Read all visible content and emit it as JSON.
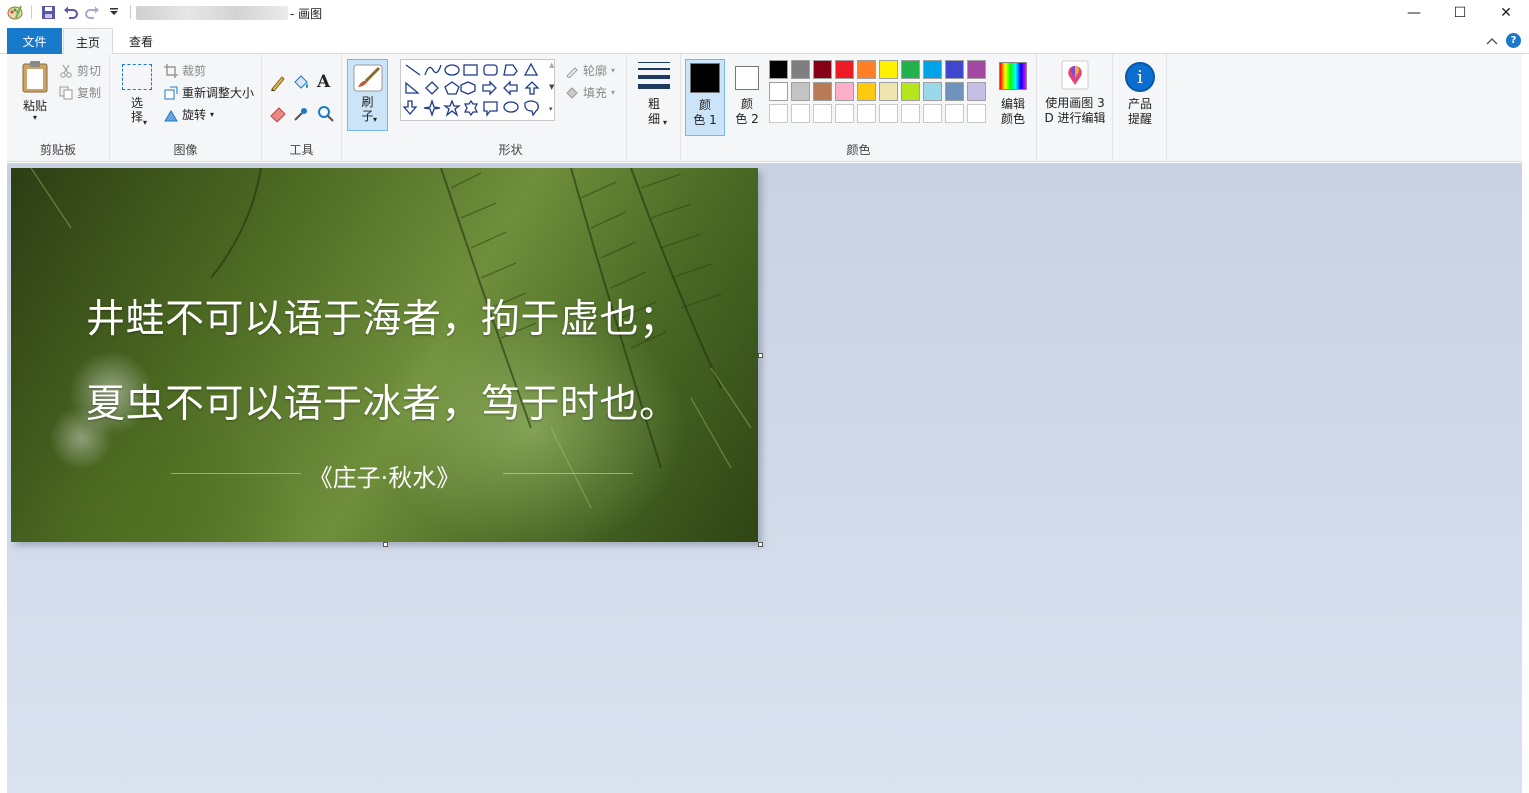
{
  "window": {
    "title_suffix": "- 画图",
    "controls": {
      "minimize": "—",
      "maximize": "☐",
      "close": "✕"
    }
  },
  "tabs": {
    "file": "文件",
    "home": "主页",
    "view": "查看"
  },
  "ribbon": {
    "clipboard": {
      "paste": "粘贴",
      "cut": "剪切",
      "copy": "复制",
      "label": "剪贴板"
    },
    "image": {
      "select_1": "选",
      "select_2": "择",
      "crop": "裁剪",
      "resize": "重新调整大小",
      "rotate": "旋转",
      "label": "图像"
    },
    "tools": {
      "label": "工具"
    },
    "brush": {
      "label_1": "刷",
      "label_2": "子"
    },
    "shapes": {
      "outline": "轮廓",
      "fill": "填充",
      "label": "形状"
    },
    "size": {
      "label_1": "粗",
      "label_2": "细"
    },
    "color1": {
      "label_1": "颜",
      "label_2": "色 1"
    },
    "color2": {
      "label_1": "颜",
      "label_2": "色 2"
    },
    "edit_colors": {
      "label_1": "编辑",
      "label_2": "颜色"
    },
    "colors_label": "颜色",
    "paint3d": {
      "label_1": "使用画图 3",
      "label_2": "D 进行编辑"
    },
    "product": {
      "label_1": "产品",
      "label_2": "提醒"
    },
    "palette_row1": [
      "#000000",
      "#7f7f7f",
      "#880015",
      "#ed1c24",
      "#ff7f27",
      "#fff200",
      "#22b14c",
      "#00a2e8",
      "#3f48cc",
      "#a349a4"
    ],
    "palette_row2": [
      "#ffffff",
      "#c3c3c3",
      "#b97a57",
      "#ffaec9",
      "#ffc90e",
      "#efe4b0",
      "#b5e61d",
      "#99d9ea",
      "#7092be",
      "#c8bfe7"
    ],
    "accent": "#1979ca"
  },
  "canvas": {
    "line1": "井蛙不可以语于海者，拘于虚也；",
    "line2": "夏虫不可以语于冰者，笃于时也。",
    "source": "《庄子·秋水》"
  }
}
